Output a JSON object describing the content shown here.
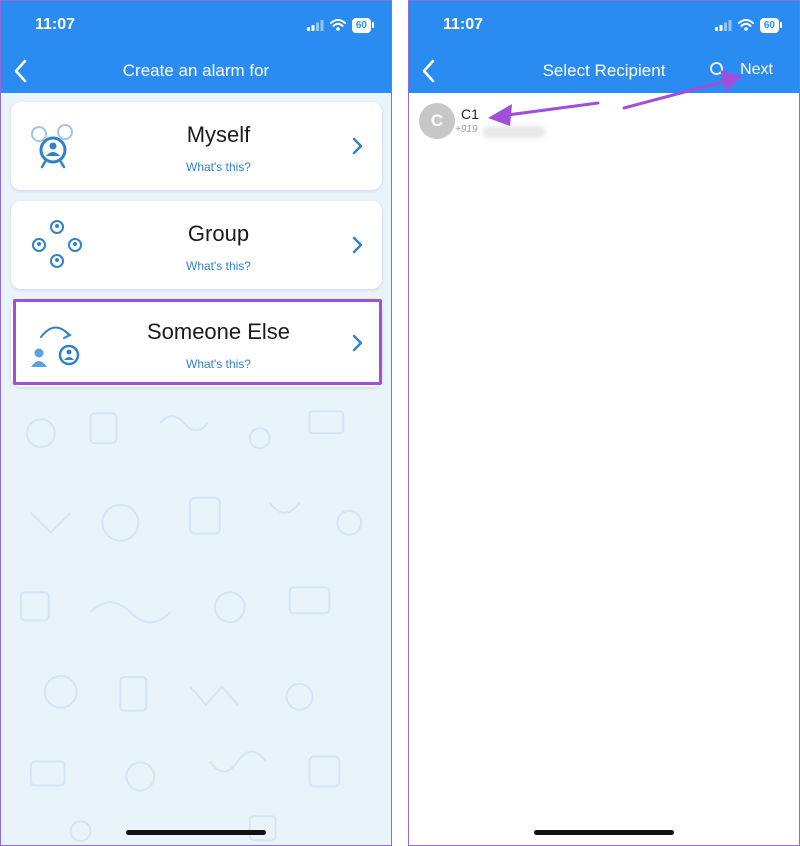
{
  "left_screen": {
    "status": {
      "time": "11:07",
      "battery": "60"
    },
    "nav": {
      "title": "Create an alarm for"
    },
    "options": [
      {
        "title": "Myself",
        "subtitle": "What's this?"
      },
      {
        "title": "Group",
        "subtitle": "What's this?"
      },
      {
        "title": "Someone Else",
        "subtitle": "What's this?"
      }
    ]
  },
  "right_screen": {
    "status": {
      "time": "11:07",
      "battery": "60"
    },
    "nav": {
      "title": "Select Recipient",
      "next_label": "Next"
    },
    "contacts": [
      {
        "initial": "C",
        "name": "C1",
        "phone_prefix": "+919"
      }
    ]
  },
  "colors": {
    "header_blue": "#2a8cf0",
    "link_blue": "#2e82c9",
    "highlight_purple": "#a04fdc",
    "background_left": "#e9f3fa"
  }
}
